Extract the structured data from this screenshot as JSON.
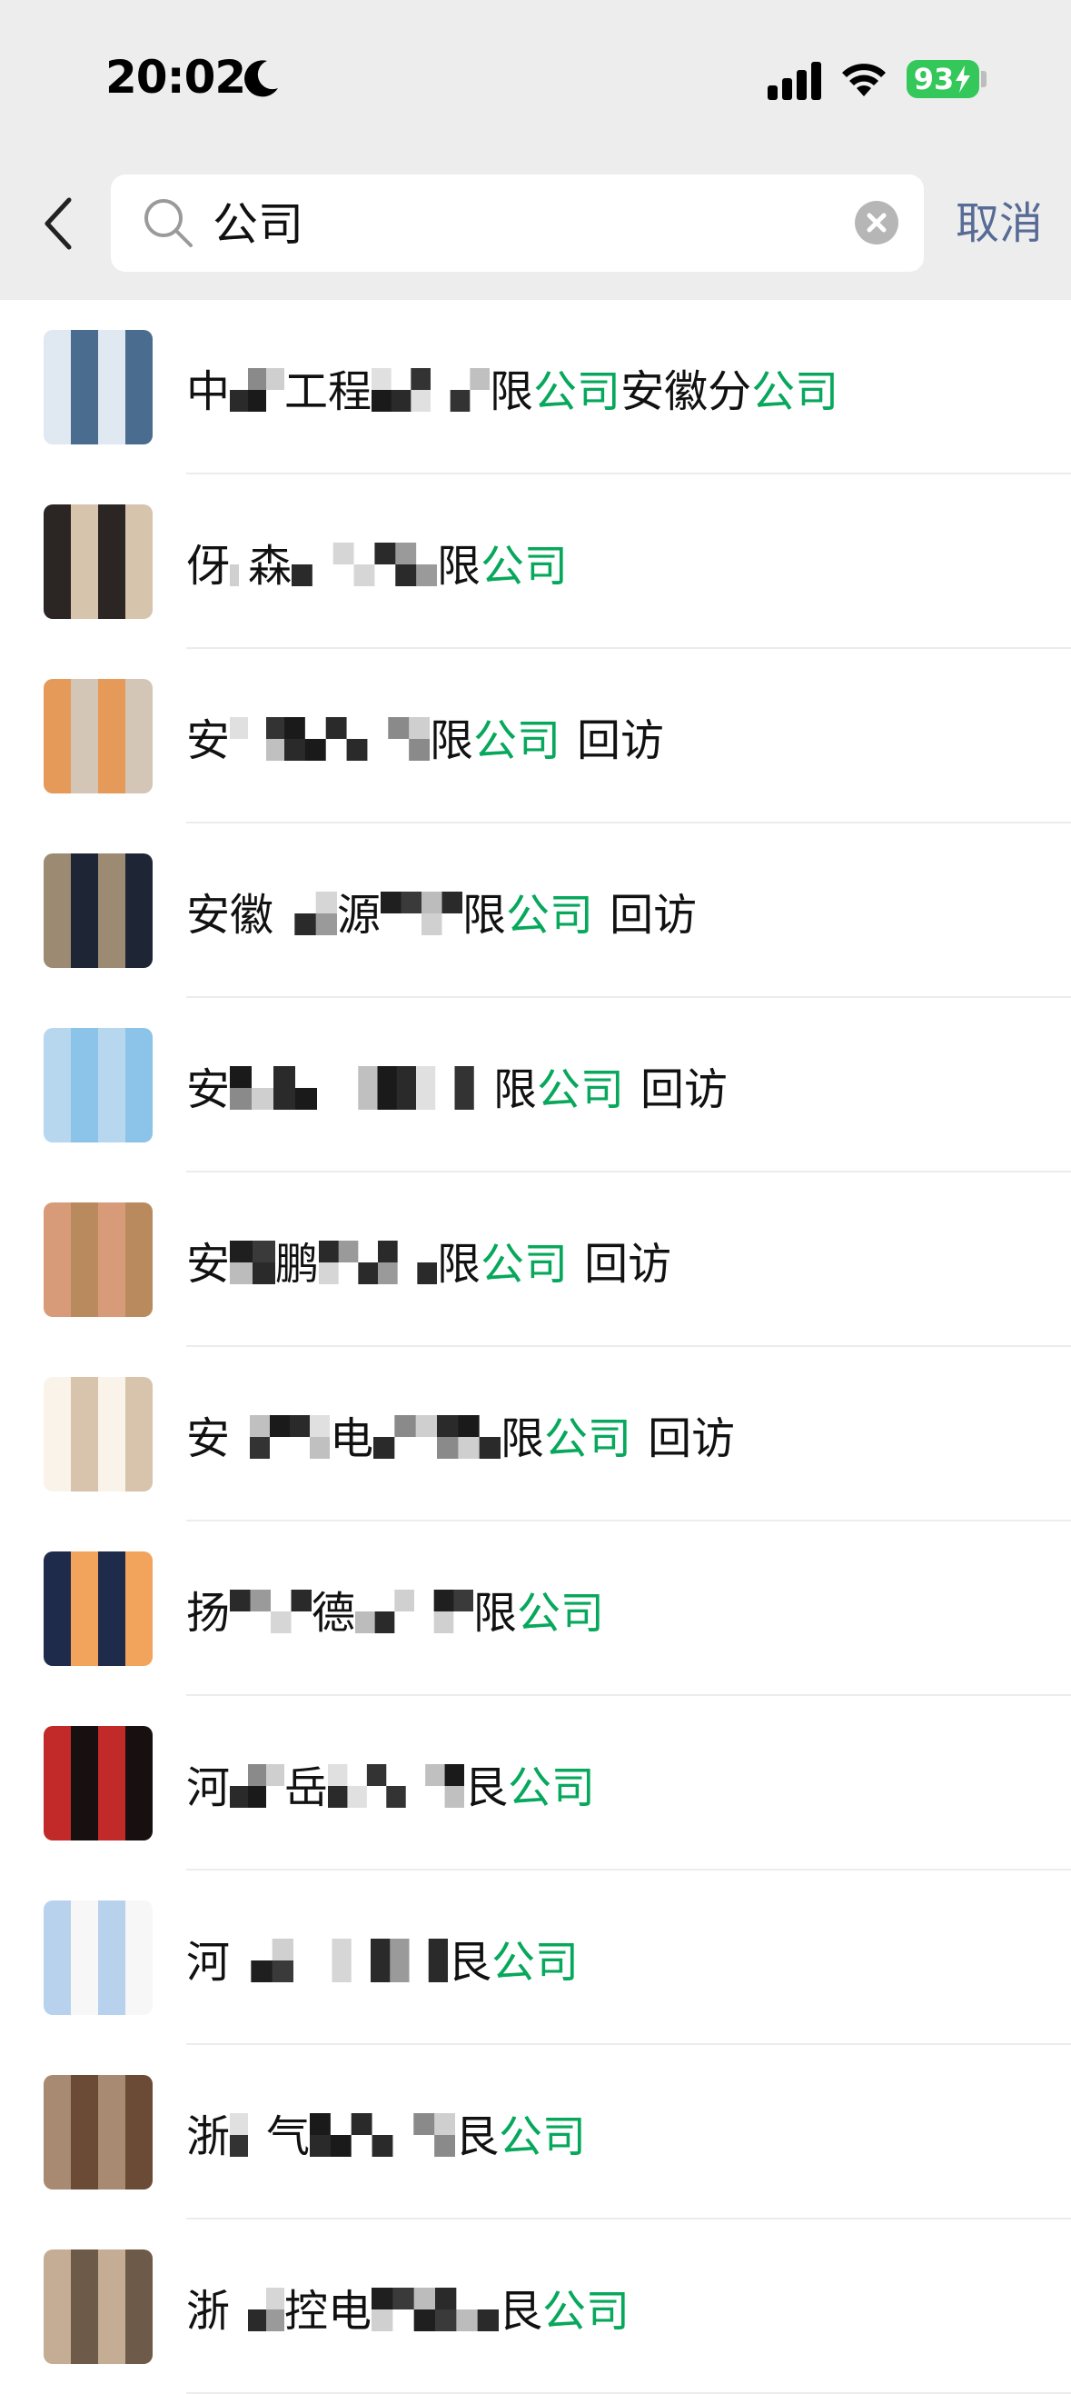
{
  "status_bar": {
    "time": "20:02",
    "battery": "93"
  },
  "search": {
    "query": "公司",
    "cancel_label": "取消"
  },
  "results": [
    {
      "prefix": "中",
      "mid": "工程",
      "pre_hl": "限",
      "hl": "公司",
      "post": "安徽分",
      "hl2": "公司",
      "suffix": ""
    },
    {
      "prefix": "伢",
      "mid": "森",
      "pre_hl": "限",
      "hl": "公司",
      "post": "",
      "hl2": "",
      "suffix": ""
    },
    {
      "prefix": "安",
      "mid": "",
      "pre_hl": "限",
      "hl": "公司",
      "post": "",
      "hl2": "",
      "suffix": "回访"
    },
    {
      "prefix": "安徽",
      "mid": "源",
      "pre_hl": "限",
      "hl": "公司",
      "post": "",
      "hl2": "",
      "suffix": "回访"
    },
    {
      "prefix": "安",
      "mid": "",
      "pre_hl": "限",
      "hl": "公司",
      "post": "",
      "hl2": "",
      "suffix": "回访"
    },
    {
      "prefix": "安",
      "mid": "鹏",
      "pre_hl": "限",
      "hl": "公司",
      "post": "",
      "hl2": "",
      "suffix": "回访"
    },
    {
      "prefix": "安",
      "mid": "电",
      "pre_hl": "限",
      "hl": "公司",
      "post": "",
      "hl2": "",
      "suffix": "回访"
    },
    {
      "prefix": "扬",
      "mid": "德",
      "pre_hl": "限",
      "hl": "公司",
      "post": "",
      "hl2": "",
      "suffix": ""
    },
    {
      "prefix": "河",
      "mid": "岳",
      "pre_hl": "艮",
      "hl": "公司",
      "post": "",
      "hl2": "",
      "suffix": ""
    },
    {
      "prefix": "河",
      "mid": "",
      "pre_hl": "艮",
      "hl": "公司",
      "post": "",
      "hl2": "",
      "suffix": ""
    },
    {
      "prefix": "浙",
      "mid": "气",
      "pre_hl": "艮",
      "hl": "公司",
      "post": "",
      "hl2": "",
      "suffix": ""
    },
    {
      "prefix": "浙",
      "mid": "控电",
      "pre_hl": "艮",
      "hl": "公司",
      "post": "",
      "hl2": "",
      "suffix": ""
    }
  ]
}
